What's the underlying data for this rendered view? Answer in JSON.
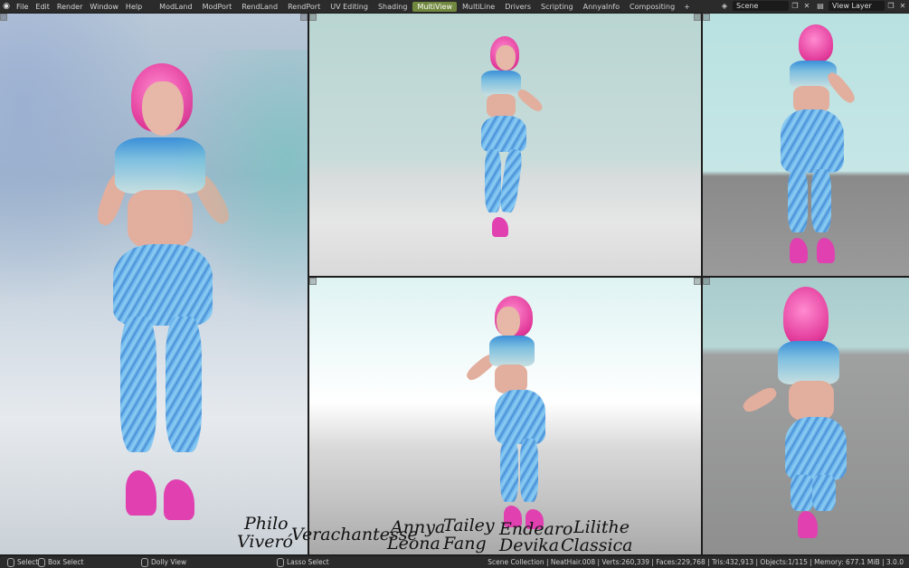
{
  "menu": [
    "File",
    "Edit",
    "Render",
    "Window",
    "Help"
  ],
  "workspaces": [
    {
      "label": "ModLand",
      "active": false
    },
    {
      "label": "ModPort",
      "active": false
    },
    {
      "label": "RendLand",
      "active": false
    },
    {
      "label": "RendPort",
      "active": false
    },
    {
      "label": "UV Editing",
      "active": false
    },
    {
      "label": "Shading",
      "active": false
    },
    {
      "label": "MultiView",
      "active": true
    },
    {
      "label": "MultiLine",
      "active": false
    },
    {
      "label": "Drivers",
      "active": false
    },
    {
      "label": "Scripting",
      "active": false
    },
    {
      "label": "AnnyaInfo",
      "active": false
    },
    {
      "label": "Compositing",
      "active": false
    }
  ],
  "add_tab": "+",
  "scene": {
    "label": "Scene"
  },
  "view_layer": {
    "label": "View Layer"
  },
  "overlay_names": [
    {
      "text": "Philo"
    },
    {
      "text": "Viveró"
    },
    {
      "text": "Verachantesse"
    },
    {
      "text": "Annya"
    },
    {
      "text": "Leona"
    },
    {
      "text": "Tailey"
    },
    {
      "text": "Fang"
    },
    {
      "text": "Endearo"
    },
    {
      "text": "Devika"
    },
    {
      "text": "Lilithe"
    },
    {
      "text": "Classica"
    }
  ],
  "status": {
    "select": "Select",
    "box_select": "Box Select",
    "dolly_view": "Dolly View",
    "lasso_select": "Lasso Select",
    "stats": "Scene Collection | NeatHair.008 | Verts:260,339 | Faces:229,768 | Tris:432,913 | Objects:1/115 | Memory: 677.1 MiB | 3.0.0"
  },
  "icons": {
    "logo": "blender-logo-icon",
    "scene": "scene-icon",
    "copy": "copy-icon",
    "close": "close-icon",
    "view_layer": "view-layer-icon"
  }
}
